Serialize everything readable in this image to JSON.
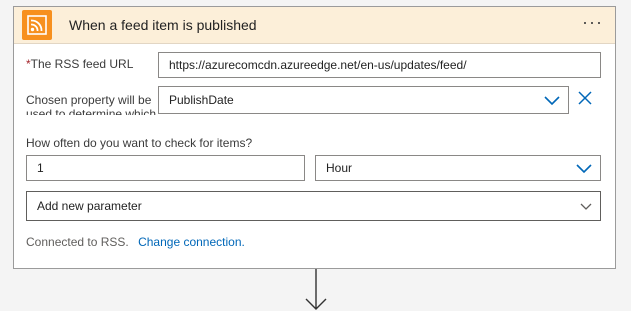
{
  "trigger": {
    "title": "When a feed item is published",
    "more_icon": "more-icon",
    "header_color": "#fcefd9",
    "rss_icon_color": "#f7901e"
  },
  "fields": {
    "feed_url": {
      "required_mark": "*",
      "label": "The RSS feed URL",
      "value": "https://azurecomcdn.azureedge.net/en-us/updates/feed/"
    },
    "chosen_property": {
      "label": "Chosen property will be used to determine which items are new",
      "value": "PublishDate"
    },
    "frequency": {
      "label": "How often do you want to check for items?",
      "interval_value": "1",
      "unit_value": "Hour"
    },
    "add_parameter": {
      "label": "Add new parameter"
    }
  },
  "connection": {
    "status": "Connected to RSS.",
    "change_link": "Change connection."
  },
  "colors": {
    "link": "#0067b8",
    "chevron": "#0067b8",
    "required": "#a4262c"
  }
}
